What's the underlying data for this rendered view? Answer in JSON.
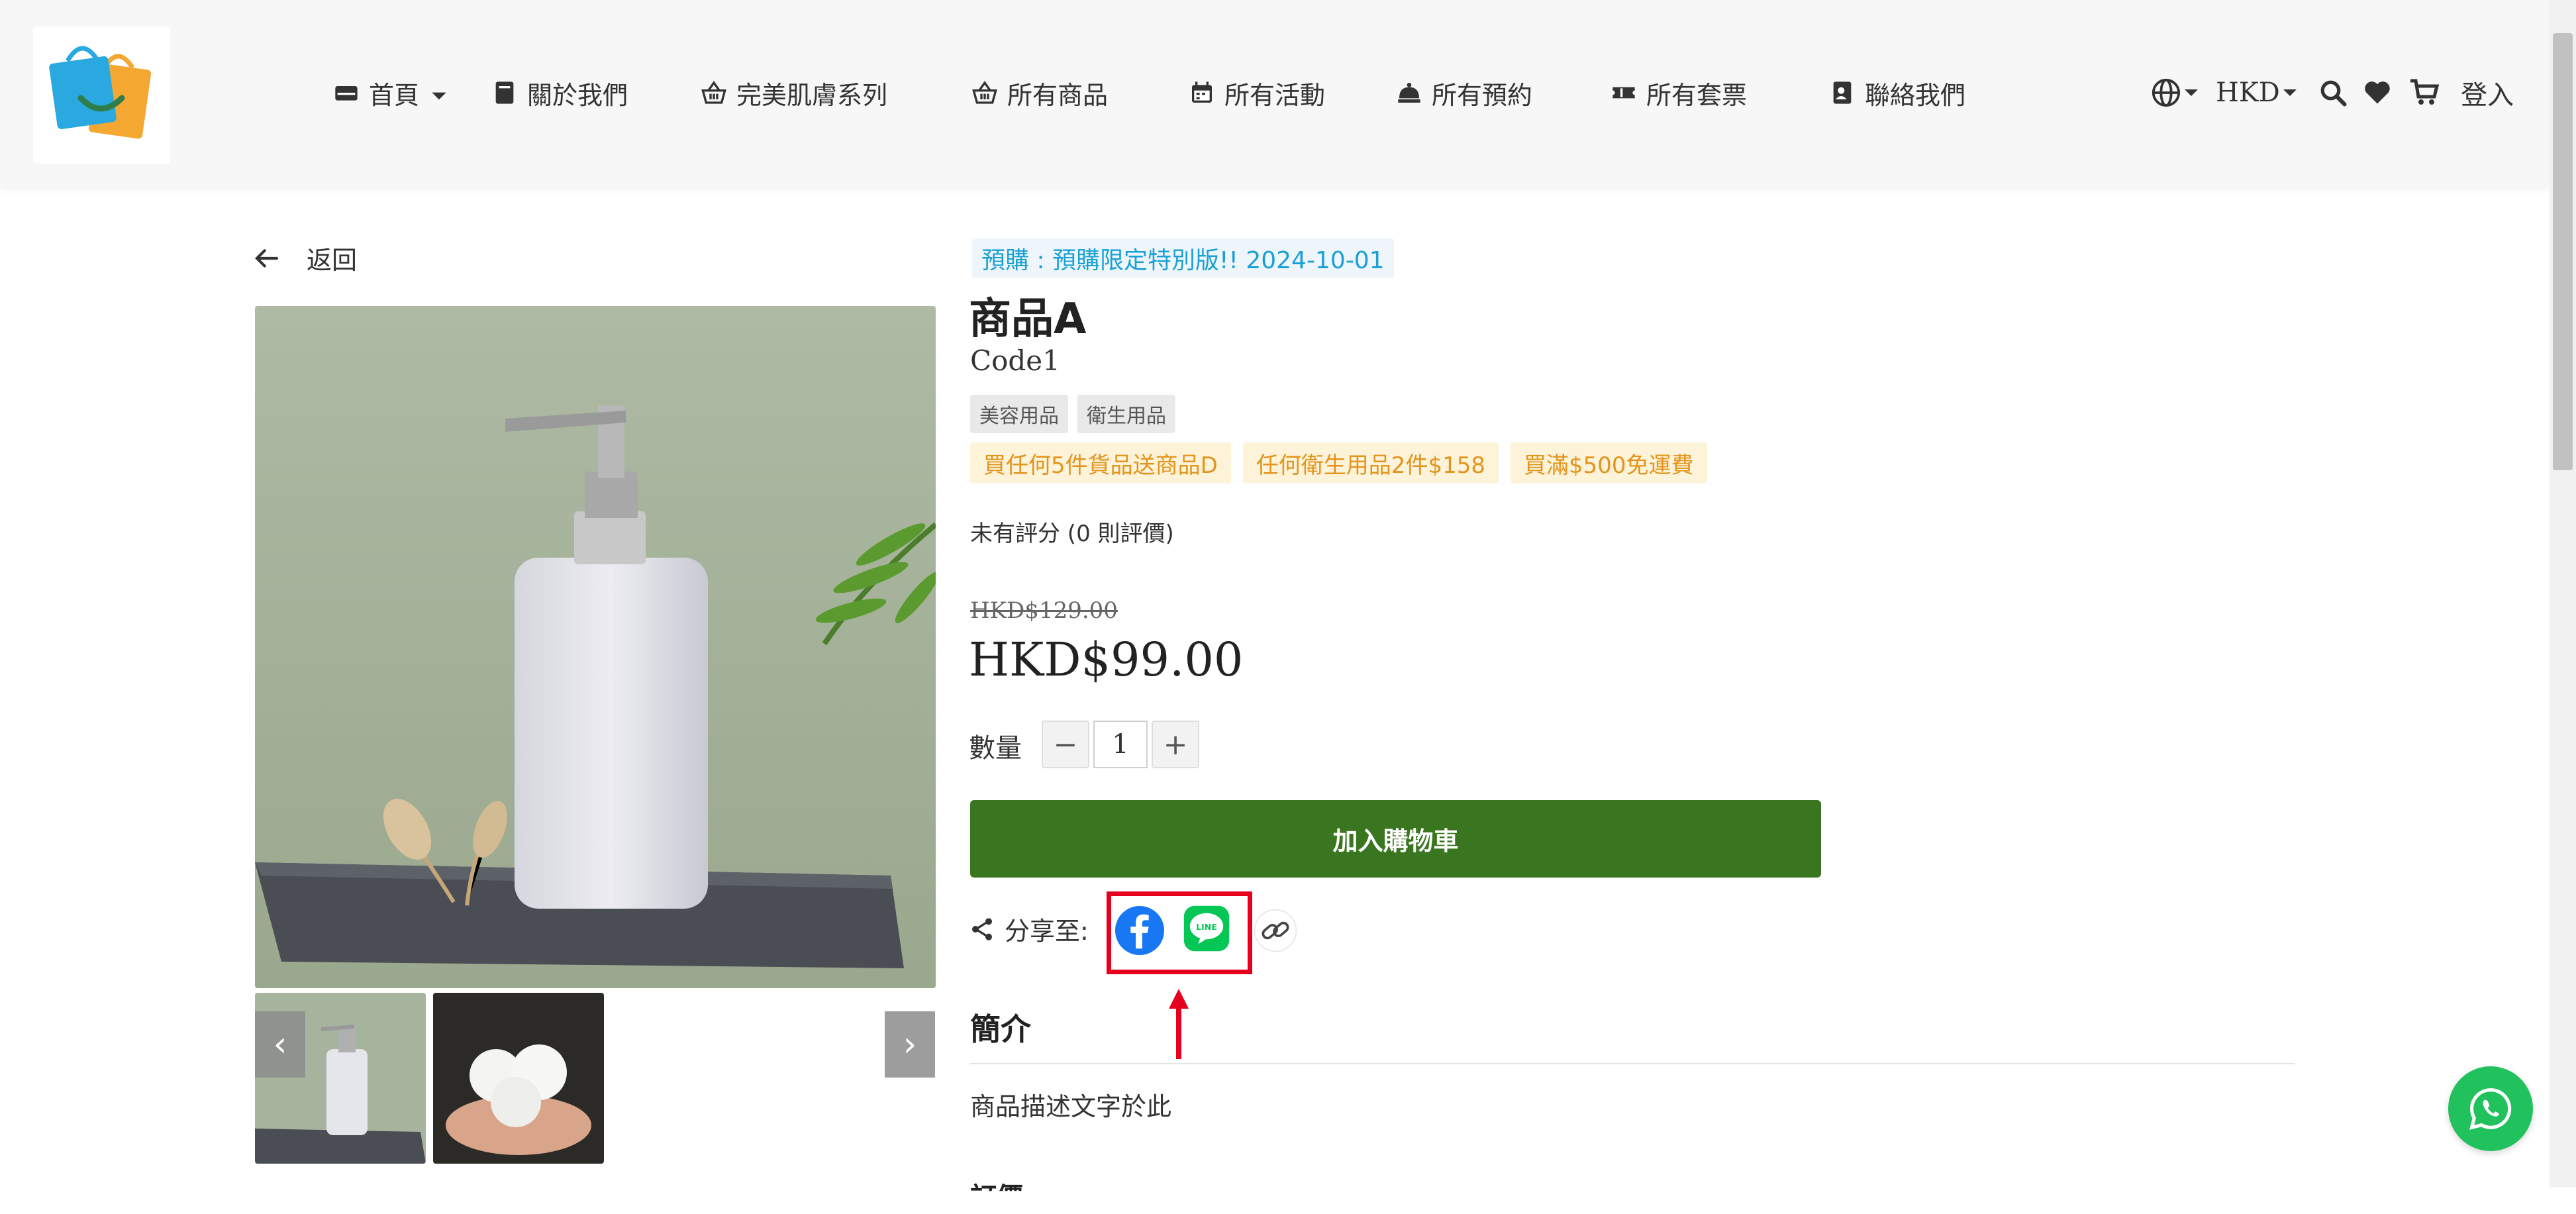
{
  "header": {
    "nav": [
      {
        "label": "首頁",
        "icon": "home-icon"
      },
      {
        "label": "關於我們",
        "icon": "book-icon"
      },
      {
        "label": "完美肌膚系列",
        "icon": "basket-icon"
      },
      {
        "label": "所有商品",
        "icon": "basket-icon"
      },
      {
        "label": "所有活動",
        "icon": "calendar-icon"
      },
      {
        "label": "所有預約",
        "icon": "bell-icon"
      },
      {
        "label": "所有套票",
        "icon": "ticket-icon"
      },
      {
        "label": "聯絡我們",
        "icon": "contact-icon"
      }
    ],
    "currency": "HKD",
    "login": "登入"
  },
  "back_label": "返回",
  "product": {
    "preorder": "預購 : 預購限定特別版!! 2024-10-01",
    "name": "商品A",
    "code": "Code1",
    "tags": [
      "美容用品",
      "衛生用品"
    ],
    "promotions": [
      "買任何5件貨品送商品D",
      "任何衛生用品2件$158",
      "買滿$500免運費"
    ],
    "rating": "未有評分 (0 則評價)",
    "original_price": "HKD$129.00",
    "price": "HKD$99.00",
    "quantity_label": "數量",
    "quantity": "1",
    "decrement": "−",
    "increment": "+",
    "add_to_cart": "加入購物車",
    "share_label": "分享至:"
  },
  "description": {
    "title": "簡介",
    "text": "商品描述文字於此"
  },
  "next_section": "訂價",
  "colors": {
    "add_to_cart_bg": "#3a7620",
    "preorder_text": "#1ba0d6",
    "promo_text": "#e3941d",
    "highlight": "#e6001f",
    "facebook": "#1877f2",
    "line": "#06c755",
    "whatsapp": "#21c25e"
  }
}
